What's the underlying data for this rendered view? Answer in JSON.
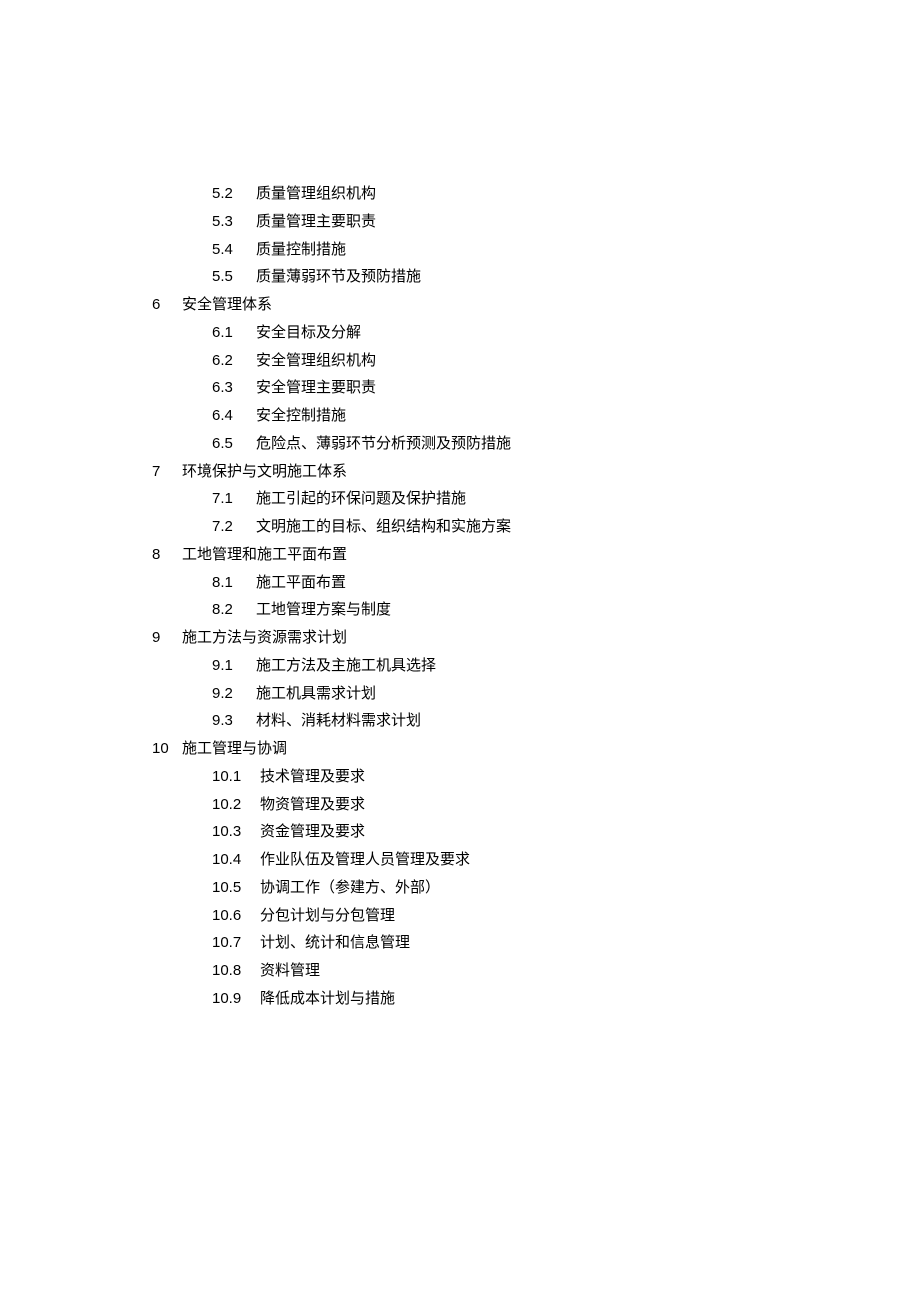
{
  "toc": [
    {
      "num": "",
      "title": "",
      "subs": [
        {
          "num": "5.2",
          "title": "质量管理组织机构"
        },
        {
          "num": "5.3",
          "title": "质量管理主要职责"
        },
        {
          "num": "5.4",
          "title": "质量控制措施"
        },
        {
          "num": "5.5",
          "title": "质量薄弱环节及预防措施"
        }
      ]
    },
    {
      "num": "6",
      "title": "安全管理体系",
      "subs": [
        {
          "num": "6.1",
          "title": "安全目标及分解"
        },
        {
          "num": "6.2",
          "title": "安全管理组织机构"
        },
        {
          "num": "6.3",
          "title": "安全管理主要职责"
        },
        {
          "num": "6.4",
          "title": "安全控制措施"
        },
        {
          "num": "6.5",
          "title": "危险点、薄弱环节分析预测及预防措施"
        }
      ]
    },
    {
      "num": "7",
      "title": "环境保护与文明施工体系",
      "subs": [
        {
          "num": "7.1",
          "title": "施工引起的环保问题及保护措施"
        },
        {
          "num": "7.2",
          "title": "文明施工的目标、组织结构和实施方案"
        }
      ]
    },
    {
      "num": "8",
      "title": "工地管理和施工平面布置",
      "subs": [
        {
          "num": "8.1",
          "title": "施工平面布置"
        },
        {
          "num": "8.2",
          "title": "工地管理方案与制度"
        }
      ]
    },
    {
      "num": "9",
      "title": "施工方法与资源需求计划",
      "subs": [
        {
          "num": "9.1",
          "title": "施工方法及主施工机具选择"
        },
        {
          "num": "9.2",
          "title": "施工机具需求计划"
        },
        {
          "num": "9.3",
          "title": "材料、消耗材料需求计划"
        }
      ]
    },
    {
      "num": "10",
      "title": "施工管理与协调",
      "subs": [
        {
          "num": "10.1",
          "title": "技术管理及要求"
        },
        {
          "num": "10.2",
          "title": "物资管理及要求"
        },
        {
          "num": "10.3",
          "title": "资金管理及要求"
        },
        {
          "num": "10.4",
          "title": "作业队伍及管理人员管理及要求"
        },
        {
          "num": "10.5",
          "title": "协调工作（参建方、外部）"
        },
        {
          "num": "10.6",
          "title": "分包计划与分包管理"
        },
        {
          "num": "10.7",
          "title": "计划、统计和信息管理"
        },
        {
          "num": "10.8",
          "title": "资料管理"
        },
        {
          "num": "10.9",
          "title": "降低成本计划与措施"
        }
      ]
    }
  ]
}
